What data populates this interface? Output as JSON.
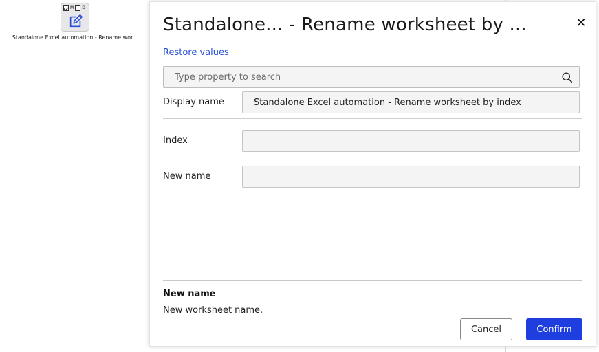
{
  "canvas": {
    "node": {
      "flag_m": "M",
      "flag_d": "D",
      "label": "Standalone Excel automation - Rename wor..."
    }
  },
  "panel": {
    "title": "Standalone... - Rename worksheet by ...",
    "close_label": "✕",
    "restore_label": "Restore values",
    "search": {
      "placeholder": "Type property to search",
      "value": ""
    },
    "fields": {
      "display_name": {
        "label": "Display name",
        "value": "Standalone Excel automation - Rename worksheet by index"
      },
      "index": {
        "label": "Index",
        "value": ""
      },
      "new_name": {
        "label": "New name",
        "value": ""
      }
    },
    "help": {
      "title": "New name",
      "text": "New worksheet name."
    },
    "buttons": {
      "cancel": "Cancel",
      "confirm": "Confirm"
    }
  },
  "colors": {
    "accent": "#1f3ee0",
    "link": "#2a4fd6"
  }
}
